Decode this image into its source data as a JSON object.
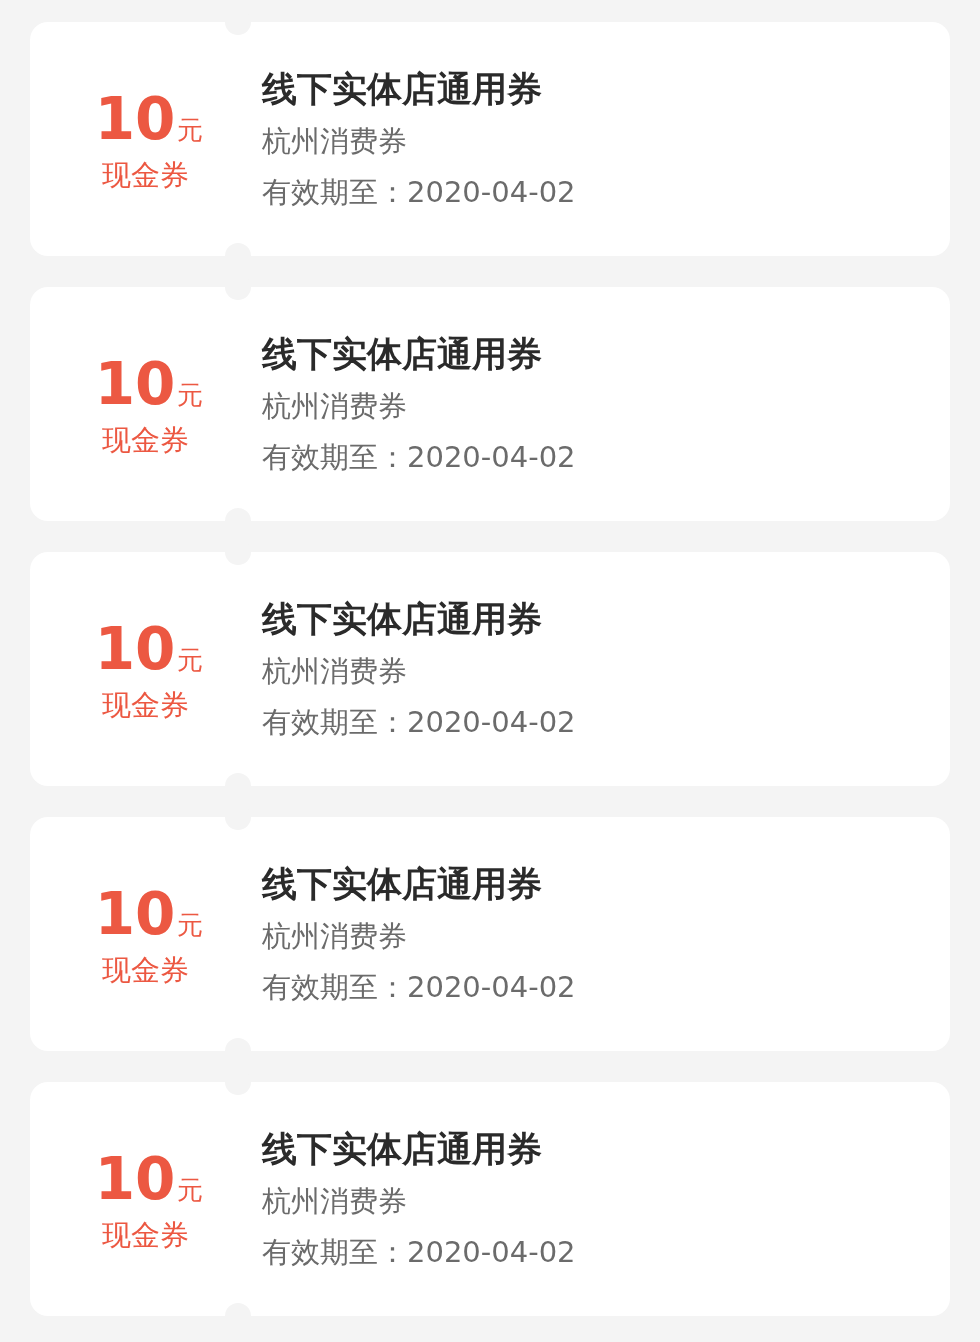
{
  "coupons": [
    {
      "amount": "10",
      "unit": "元",
      "type": "现金券",
      "title": "线下实体店通用券",
      "subtitle": "杭州消费券",
      "expiry": "有效期至：2020-04-02"
    },
    {
      "amount": "10",
      "unit": "元",
      "type": "现金券",
      "title": "线下实体店通用券",
      "subtitle": "杭州消费券",
      "expiry": "有效期至：2020-04-02"
    },
    {
      "amount": "10",
      "unit": "元",
      "type": "现金券",
      "title": "线下实体店通用券",
      "subtitle": "杭州消费券",
      "expiry": "有效期至：2020-04-02"
    },
    {
      "amount": "10",
      "unit": "元",
      "type": "现金券",
      "title": "线下实体店通用券",
      "subtitle": "杭州消费券",
      "expiry": "有效期至：2020-04-02"
    },
    {
      "amount": "10",
      "unit": "元",
      "type": "现金券",
      "title": "线下实体店通用券",
      "subtitle": "杭州消费券",
      "expiry": "有效期至：2020-04-02"
    }
  ]
}
